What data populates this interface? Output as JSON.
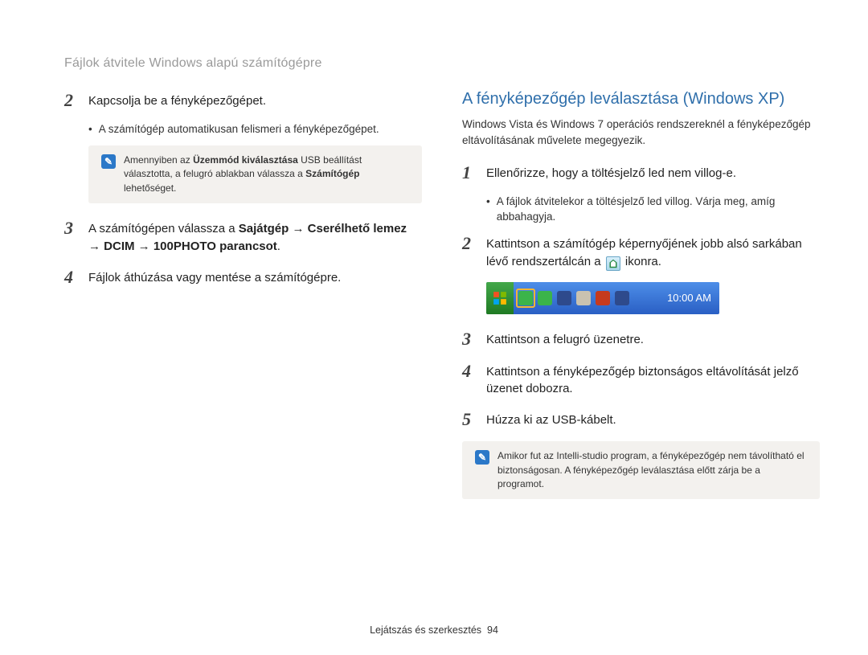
{
  "breadcrumb": "Fájlok átvitele Windows alapú számítógépre",
  "left": {
    "step2": {
      "num": "2",
      "txt": "Kapcsolja be a fényképezőgépet."
    },
    "bullet2": "A számítógép automatikusan felismeri a fényképezőgépet.",
    "note1_pre": "Amennyiben az ",
    "note1_b1": "Üzemmód kiválasztása",
    "note1_mid": " USB beállítást választotta, a felugró ablakban válassza a ",
    "note1_b2": "Számítógép",
    "note1_post": " lehetőséget.",
    "step3": {
      "num": "3",
      "pre": "A számítógépen válassza a ",
      "b1": "Sajátgép",
      "arr": " → ",
      "b2": "Cserélhető lemez",
      "b3": "DCIM",
      "b4": "100PHOTO parancsot"
    },
    "step4": {
      "num": "4",
      "txt": "Fájlok áthúzása vagy mentése a számítógépre."
    }
  },
  "right": {
    "heading": "A fényképezőgép leválasztása (Windows XP)",
    "sub": "Windows Vista és Windows 7 operációs rendszereknél a fényképezőgép eltávolításának művelete megegyezik.",
    "step1": {
      "num": "1",
      "txt": "Ellenőrizze, hogy a töltésjelző led nem villog-e."
    },
    "bullet1": "A fájlok átvitelekor a töltésjelző led villog. Várja meg, amíg abbahagyja.",
    "step2": {
      "num": "2",
      "pre": "Kattintson a számítógép képernyőjének jobb alsó sarkában lévő rendszertálcán a ",
      "post": " ikonra."
    },
    "clock": "10:00 AM",
    "step3": {
      "num": "3",
      "txt": "Kattintson a felugró üzenetre."
    },
    "step4": {
      "num": "4",
      "txt": "Kattintson a fényképezőgép biztonságos eltávolítását jelző üzenet dobozra."
    },
    "step5": {
      "num": "5",
      "txt": "Húzza ki az USB-kábelt."
    },
    "note2": "Amikor fut az Intelli-studio program, a fényképezőgép nem távolítható el biztonságosan. A fényképezőgép leválasztása előtt zárja be a programot."
  },
  "footer": {
    "label": "Lejátszás és szerkesztés",
    "page": "94"
  }
}
